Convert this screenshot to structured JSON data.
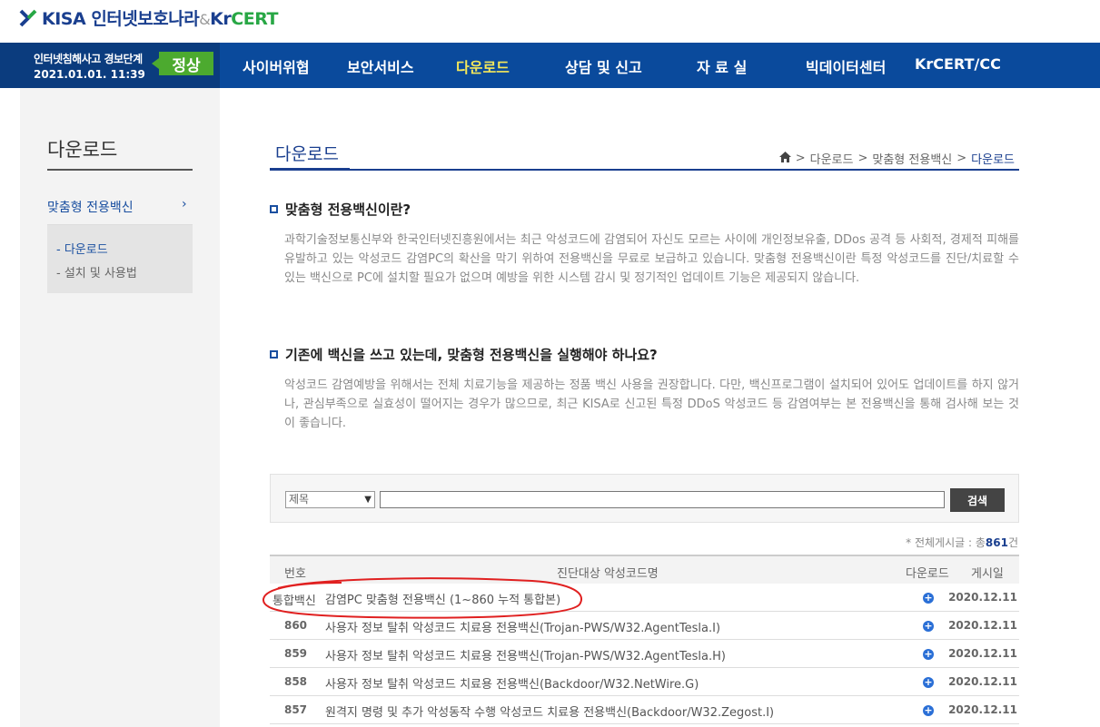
{
  "header": {
    "logo_kisa": "KISA",
    "logo_name": "인터넷보호나라",
    "logo_amp": "&",
    "logo_kr": "Kr",
    "logo_cert": "CERT"
  },
  "alert": {
    "title": "인터넷침해사고 경보단계",
    "time": "2021.01.01. 11:39",
    "level": "정상"
  },
  "nav": {
    "items": [
      "사이버위협",
      "보안서비스",
      "다운로드",
      "상담 및 신고",
      "자 료 실",
      "빅데이터센터",
      "KrCERT/CC"
    ],
    "active_index": 2
  },
  "sidebar": {
    "title": "다운로드",
    "menu": "맞춤형 전용백신",
    "sub": [
      "- 다운로드",
      "- 설치 및 사용법"
    ]
  },
  "main": {
    "title": "다운로드",
    "breadcrumb": [
      "다운로드",
      "맞춤형 전용백신",
      "다운로드"
    ],
    "q1": {
      "heading": "맞춤형 전용백신이란?",
      "body": "과학기술정보통신부와 한국인터넷진흥원에서는 최근 악성코드에 감염되어 자신도 모르는 사이에 개인정보유출, DDos 공격 등 사회적, 경제적 피해를 유발하고 있는 악성코드 감염PC의 확산을 막기 위하여 전용백신을 무료로 보급하고 있습니다. 맞춤형 전용백신이란 특정 악성코드를 진단/치료할 수 있는 백신으로 PC에 설치할 필요가 없으며 예방을 위한 시스템 감시 및 정기적인 업데이트 기능은 제공되지 않습니다."
    },
    "q2": {
      "heading": "기존에 백신을 쓰고 있는데, 맞춤형 전용백신을 실행해야 하나요?",
      "body": "악성코드 감염예방을 위해서는 전체 치료기능을 제공하는 정품 백신 사용을 권장합니다. 다만, 백신프로그램이 설치되어 있어도 업데이트를 하지 않거나, 관심부족으로 실효성이 떨어지는 경우가 많으므로, 최근 KISA로 신고된 특정 DDoS 악성코드 등 감염여부는 본 전용백신을 통해 검사해 보는 것이 좋습니다."
    }
  },
  "search": {
    "select_value": "제목",
    "input_value": "",
    "button": "검색"
  },
  "total": {
    "prefix": "* 전체게시글 : 총",
    "count": "861",
    "suffix": "건"
  },
  "table": {
    "headers": [
      "번호",
      "진단대상 악성코드명",
      "다운로드",
      "게시일"
    ],
    "rows": [
      {
        "num": "통합백신",
        "title": "감염PC 맞춤형 전용백신 (1~860 누적 통합본)",
        "date": "2020.12.11"
      },
      {
        "num": "860",
        "title": "사용자 정보 탈취 악성코드 치료용 전용백신(Trojan-PWS/W32.AgentTesla.I)",
        "date": "2020.12.11"
      },
      {
        "num": "859",
        "title": "사용자 정보 탈취 악성코드 치료용 전용백신(Trojan-PWS/W32.AgentTesla.H)",
        "date": "2020.12.11"
      },
      {
        "num": "858",
        "title": "사용자 정보 탈취 악성코드 치료용 전용백신(Backdoor/W32.NetWire.G)",
        "date": "2020.12.11"
      },
      {
        "num": "857",
        "title": "원격지 명령 및 추가 악성동작 수행 악성코드 치료용 전용백신(Backdoor/W32.Zegost.I)",
        "date": "2020.12.11"
      }
    ]
  },
  "colors": {
    "nav_bg": "#0a4a9c",
    "alert_bg": "#0b3c7e",
    "badge_green": "#4caa2f",
    "active_nav": "#f5e85a",
    "accent_blue": "#1a3f8f",
    "annotation_red": "#e02020"
  }
}
